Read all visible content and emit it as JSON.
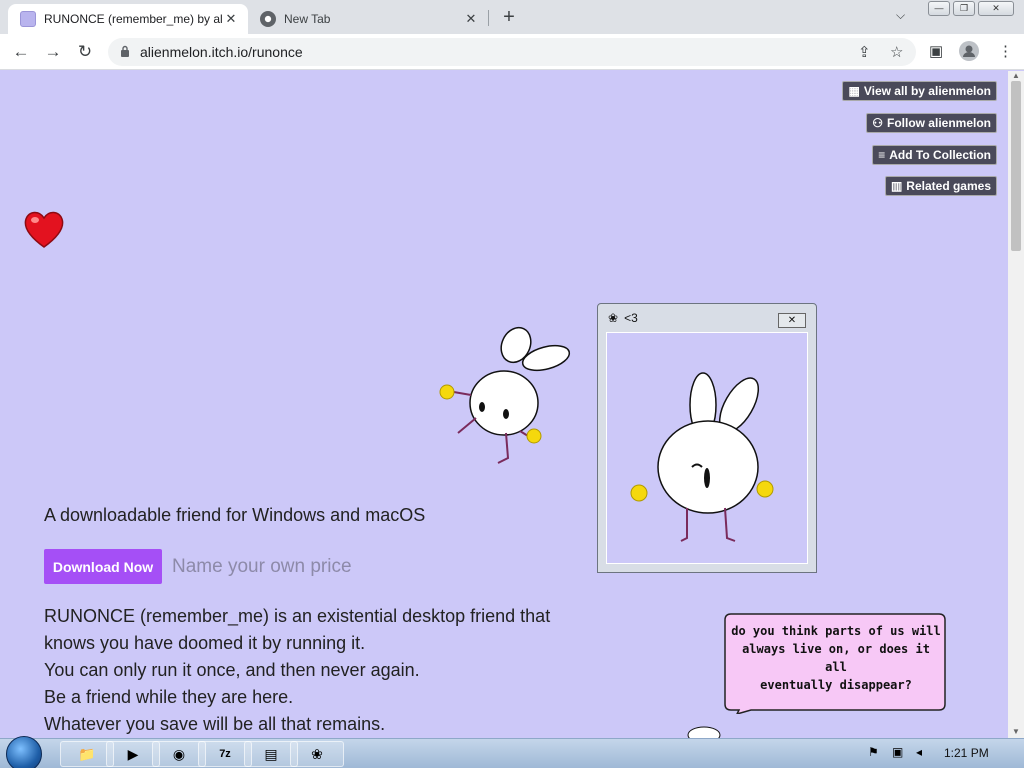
{
  "browser": {
    "tabs": [
      {
        "title": "RUNONCE (remember_me) by alienmelon",
        "active": true
      },
      {
        "title": "New Tab",
        "active": false
      }
    ],
    "new_tab": "+",
    "address": "alienmelon.itch.io/runonce"
  },
  "page": {
    "buttons": [
      {
        "label": "View all by alienmelon",
        "icon": "gamepad-icon"
      },
      {
        "label": "Follow alienmelon",
        "icon": "user-plus-icon"
      },
      {
        "label": "Add To Collection",
        "icon": "playlist-add-icon"
      },
      {
        "label": "Related games",
        "icon": "map-icon"
      }
    ],
    "tagline": "A downloadable friend for Windows and macOS",
    "download_label": "Download Now",
    "price_text": "Name your own price",
    "body_lines": [
      "RUNONCE (remember_me) is an existential desktop friend that",
      "knows you have doomed it by running it.",
      "You can only run it once, and then never again.",
      "Be a friend while they are here.",
      "Whatever you save will be all that remains."
    ],
    "friend_window_title": "<3",
    "speech_lines": [
      "do you think parts of us will",
      "always live on, or does it all",
      "eventually disappear?"
    ]
  },
  "taskbar": {
    "clock": "1:21 PM"
  },
  "colors": {
    "page_bg": "#ccc8f8",
    "download_button": "#a54ff6",
    "itch_button": "#4a4a5a",
    "bubble": "#f7c8f6"
  }
}
